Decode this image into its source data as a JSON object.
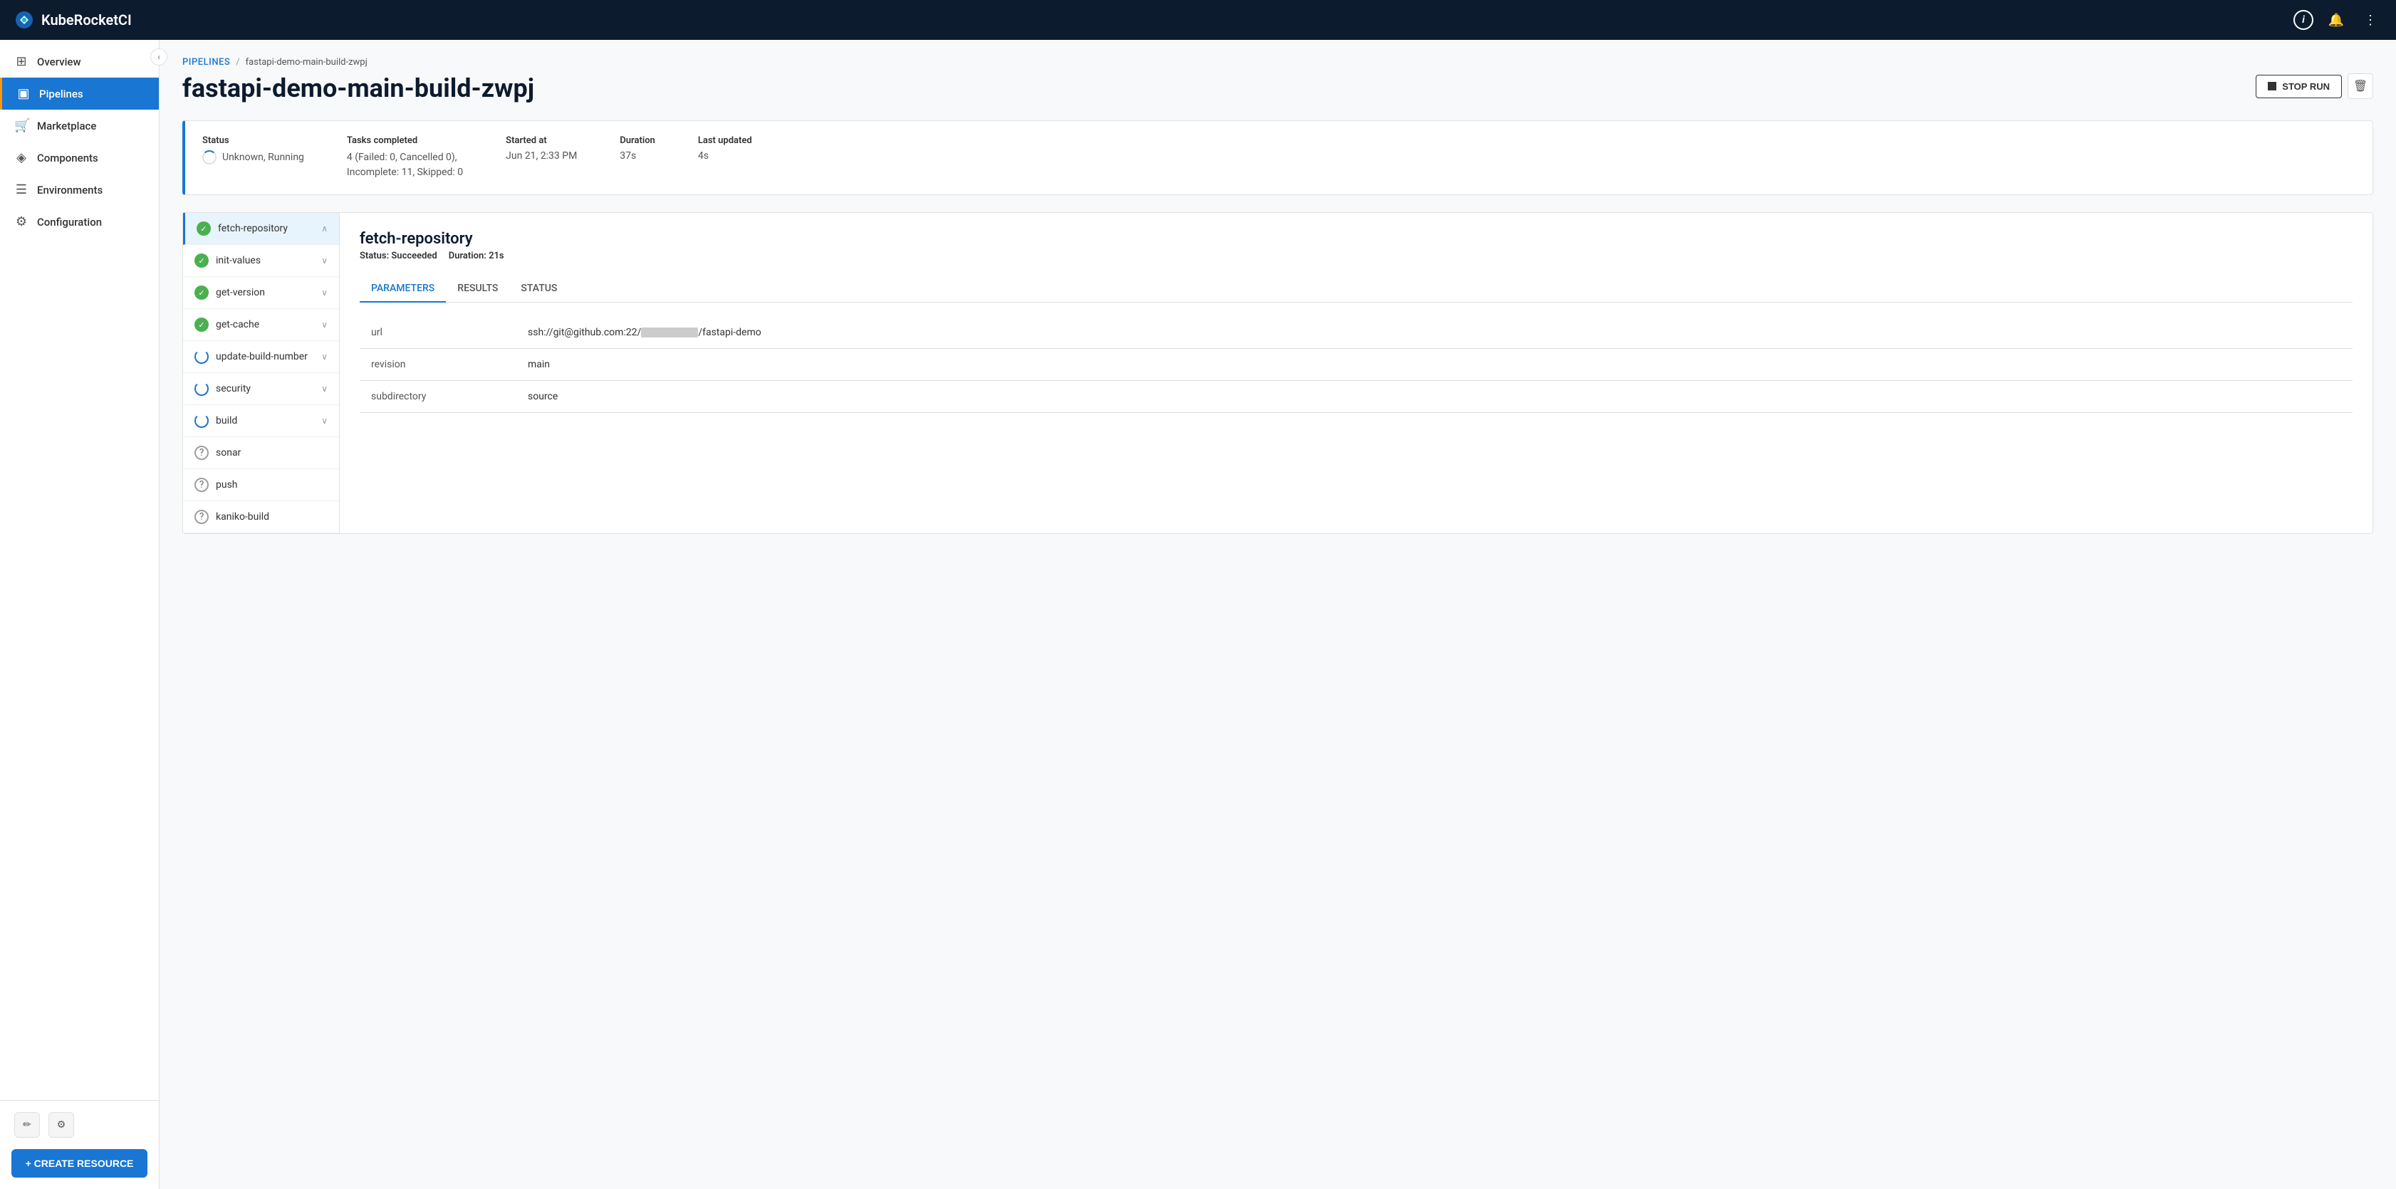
{
  "app": {
    "title": "KubeRocketCI"
  },
  "header": {
    "info_label": "i",
    "stop_run_label": "STOP RUN",
    "delete_label": "🗑"
  },
  "sidebar": {
    "collapse_icon": "‹",
    "items": [
      {
        "id": "overview",
        "label": "Overview",
        "icon": "⊞"
      },
      {
        "id": "pipelines",
        "label": "Pipelines",
        "icon": "▣",
        "active": true
      },
      {
        "id": "marketplace",
        "label": "Marketplace",
        "icon": "🛒"
      },
      {
        "id": "components",
        "label": "Components",
        "icon": "◈"
      },
      {
        "id": "environments",
        "label": "Environments",
        "icon": "☰"
      },
      {
        "id": "configuration",
        "label": "Configuration",
        "icon": "⚙"
      }
    ],
    "bottom_buttons": [
      {
        "id": "edit",
        "icon": "✏"
      },
      {
        "id": "settings",
        "icon": "⚙"
      }
    ],
    "create_resource_label": "+ CREATE RESOURCE"
  },
  "breadcrumb": {
    "pipelines_label": "PIPELINES",
    "separator": "/",
    "current": "fastapi-demo-main-build-zwpj"
  },
  "page_title": "fastapi-demo-main-build-zwpj",
  "status_card": {
    "status_label": "Status",
    "status_value": "Unknown, Running",
    "tasks_label": "Tasks completed",
    "tasks_value": "4 (Failed: 0, Cancelled 0),\nIncomplete: 11, Skipped: 0",
    "started_label": "Started at",
    "started_value": "Jun 21, 2:33 PM",
    "duration_label": "Duration",
    "duration_value": "37s",
    "last_updated_label": "Last updated",
    "last_updated_value": "4s"
  },
  "tasks": [
    {
      "id": "fetch-repository",
      "label": "fetch-repository",
      "status": "success",
      "active": true
    },
    {
      "id": "init-values",
      "label": "init-values",
      "status": "success"
    },
    {
      "id": "get-version",
      "label": "get-version",
      "status": "success"
    },
    {
      "id": "get-cache",
      "label": "get-cache",
      "status": "success"
    },
    {
      "id": "update-build-number",
      "label": "update-build-number",
      "status": "running"
    },
    {
      "id": "security",
      "label": "security",
      "status": "running"
    },
    {
      "id": "build",
      "label": "build",
      "status": "running"
    },
    {
      "id": "sonar",
      "label": "sonar",
      "status": "unknown"
    },
    {
      "id": "push",
      "label": "push",
      "status": "unknown"
    },
    {
      "id": "kaniko-build",
      "label": "kaniko-build",
      "status": "unknown"
    }
  ],
  "task_detail": {
    "title": "fetch-repository",
    "status_label": "Status:",
    "status_value": "Succeeded",
    "duration_label": "Duration:",
    "duration_value": "21s",
    "tabs": [
      {
        "id": "parameters",
        "label": "PARAMETERS",
        "active": true
      },
      {
        "id": "results",
        "label": "RESULTS"
      },
      {
        "id": "status",
        "label": "STATUS"
      }
    ],
    "parameters": [
      {
        "key": "url",
        "value_prefix": "ssh://git@github.com:22/",
        "value_suffix": "/fastapi-demo",
        "redacted": true
      },
      {
        "key": "revision",
        "value": "main"
      },
      {
        "key": "subdirectory",
        "value": "source"
      }
    ]
  }
}
